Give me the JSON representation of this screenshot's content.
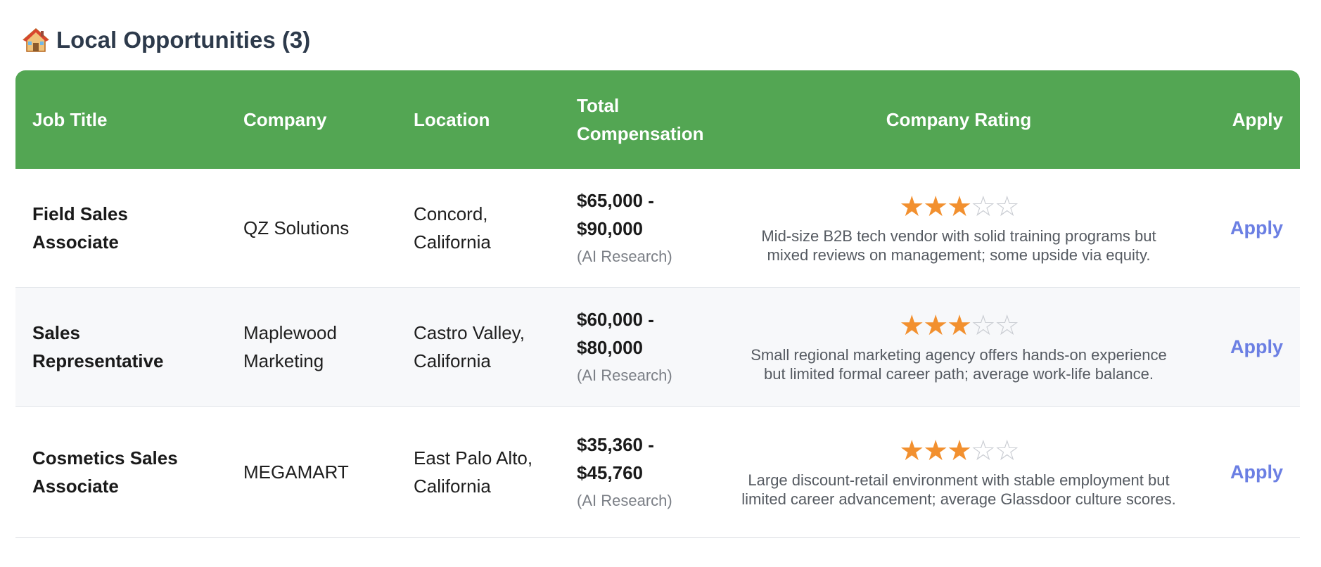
{
  "section": {
    "icon": "house-icon",
    "title": "Local Opportunities (3)"
  },
  "table": {
    "headers": {
      "job_title": "Job Title",
      "company": "Company",
      "location": "Location",
      "compensation_line1": "Total",
      "compensation_line2": "Compensation",
      "rating": "Company Rating",
      "apply": "Apply"
    },
    "rows": [
      {
        "job_title_line1": "Field Sales",
        "job_title_line2": "Associate",
        "company_line1": "QZ Solutions",
        "company_line2": "",
        "location_line1": "Concord,",
        "location_line2": "California",
        "comp_line1": "$65,000 -",
        "comp_line2": "$90,000",
        "comp_source": "(AI Research)",
        "rating": 3,
        "rating_max": 5,
        "stars_full": "★★★",
        "stars_empty": "☆☆",
        "rating_desc": "Mid-size B2B tech vendor with solid training programs but mixed reviews on management; some upside via equity.",
        "apply_label": "Apply"
      },
      {
        "job_title_line1": "Sales",
        "job_title_line2": "Representative",
        "company_line1": "Maplewood",
        "company_line2": "Marketing",
        "location_line1": "Castro Valley,",
        "location_line2": "California",
        "comp_line1": "$60,000 -",
        "comp_line2": "$80,000",
        "comp_source": "(AI Research)",
        "rating": 3,
        "rating_max": 5,
        "stars_full": "★★★",
        "stars_empty": "☆☆",
        "rating_desc": "Small regional marketing agency offers hands-on experience but limited formal career path; average work-life balance.",
        "apply_label": "Apply"
      },
      {
        "job_title_line1": "Cosmetics Sales",
        "job_title_line2": "Associate",
        "company_line1": "MEGAMART",
        "company_line2": "",
        "location_line1": "East Palo Alto,",
        "location_line2": "California",
        "comp_line1": "$35,360 -",
        "comp_line2": "$45,760",
        "comp_source": "(AI Research)",
        "rating": 3,
        "rating_max": 5,
        "stars_full": "★★★",
        "stars_empty": "☆☆",
        "rating_desc": "Large discount-retail environment with stable employment but limited career advancement; average Glassdoor culture scores.",
        "apply_label": "Apply"
      }
    ]
  },
  "colors": {
    "header_bg": "#53a653",
    "star": "#f2902f",
    "apply_link": "#6b7fe3",
    "heading_text": "#2d3a4b"
  }
}
